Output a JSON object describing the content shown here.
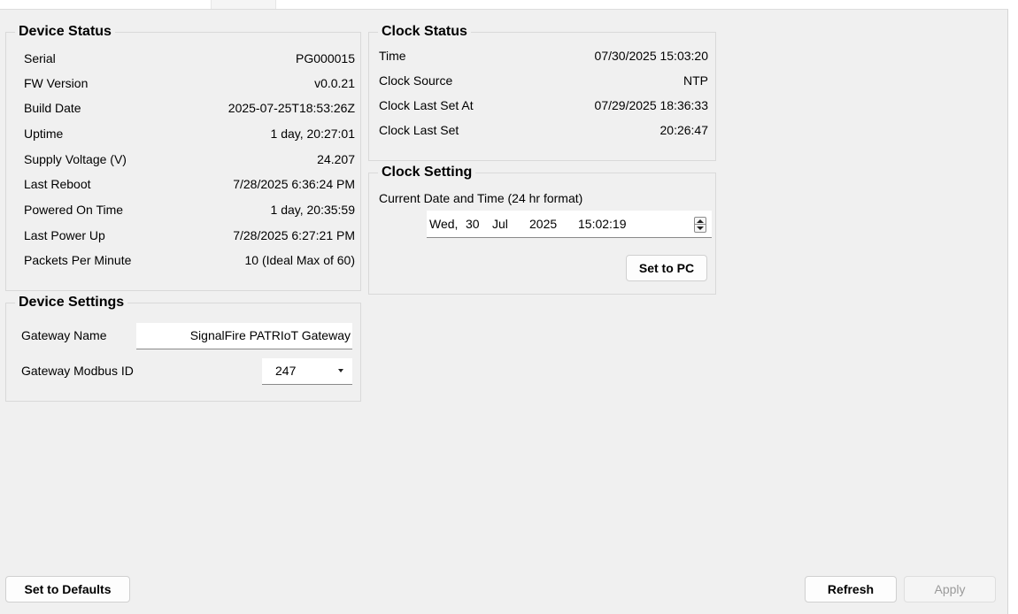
{
  "device_status": {
    "title": "Device Status",
    "rows": [
      {
        "label": "Serial",
        "value": "PG000015"
      },
      {
        "label": "FW Version",
        "value": "v0.0.21"
      },
      {
        "label": "Build Date",
        "value": "2025-07-25T18:53:26Z"
      },
      {
        "label": "Uptime",
        "value": "1 day, 20:27:01"
      },
      {
        "label": "Supply Voltage (V)",
        "value": "24.207"
      },
      {
        "label": "Last Reboot",
        "value": "7/28/2025 6:36:24 PM"
      },
      {
        "label": "Powered On Time",
        "value": "1 day, 20:35:59"
      },
      {
        "label": "Last Power Up",
        "value": "7/28/2025 6:27:21 PM"
      },
      {
        "label": "Packets Per Minute",
        "value": "10 (Ideal Max of 60)"
      }
    ]
  },
  "device_settings": {
    "title": "Device Settings",
    "gateway_name_label": "Gateway Name",
    "gateway_name_value": "SignalFire PATRIoT Gateway",
    "modbus_id_label": "Gateway Modbus ID",
    "modbus_id_value": "247"
  },
  "clock_status": {
    "title": "Clock Status",
    "rows": [
      {
        "label": "Time",
        "value": "07/30/2025 15:03:20"
      },
      {
        "label": "Clock Source",
        "value": "NTP"
      },
      {
        "label": "Clock Last Set At",
        "value": "07/29/2025 18:36:33"
      },
      {
        "label": "Clock Last Set",
        "value": "20:26:47"
      }
    ]
  },
  "clock_setting": {
    "title": "Clock Setting",
    "caption": "Current Date and Time (24 hr format)",
    "datetime": {
      "weekday": "Wed,",
      "day": "30",
      "month": "Jul",
      "year": "2025",
      "time": "15:02:19"
    },
    "set_to_pc_label": "Set to PC"
  },
  "footer": {
    "set_defaults_label": "Set to Defaults",
    "refresh_label": "Refresh",
    "apply_label": "Apply"
  },
  "icons": {
    "spinner": "up-down-spin-icon",
    "dropdown": "chevron-down-icon"
  }
}
